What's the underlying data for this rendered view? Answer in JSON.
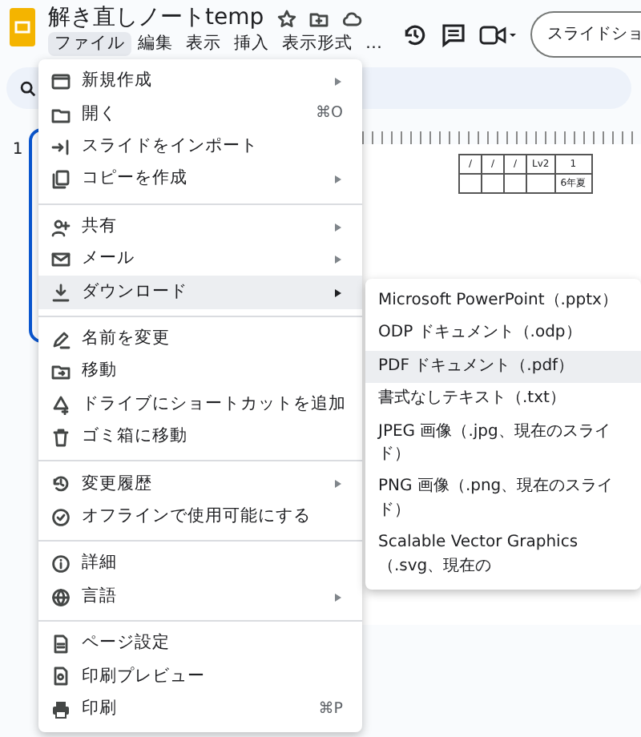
{
  "app": {
    "title": "解き直しノートtemp",
    "menubar": [
      {
        "label": "ファイル",
        "selected": true
      },
      {
        "label": "編集",
        "selected": false
      },
      {
        "label": "表示",
        "selected": false
      },
      {
        "label": "挿入",
        "selected": false
      },
      {
        "label": "表示形式",
        "selected": false
      },
      {
        "label": "…",
        "selected": false
      }
    ],
    "slideshow_button": "スライドショ"
  },
  "thumbnails": [
    {
      "number": "1",
      "selected": true
    }
  ],
  "slide": {
    "table": {
      "rows": [
        [
          "/",
          "/",
          "/",
          "Lv2",
          "1"
        ],
        [
          null,
          null,
          null,
          null,
          "6年夏"
        ]
      ]
    }
  },
  "file_menu": {
    "sections": [
      [
        {
          "label": "新規作成",
          "has_submenu": true,
          "selected": false
        },
        {
          "label": "開く",
          "shortcut": "⌘O",
          "has_submenu": false,
          "selected": false
        },
        {
          "label": "スライドをインポート",
          "has_submenu": false,
          "selected": false
        },
        {
          "label": "コピーを作成",
          "has_submenu": true,
          "selected": false
        }
      ],
      [
        {
          "label": "共有",
          "has_submenu": true,
          "selected": false
        },
        {
          "label": "メール",
          "has_submenu": true,
          "selected": false
        },
        {
          "label": "ダウンロード",
          "has_submenu": true,
          "selected": true
        }
      ],
      [
        {
          "label": "名前を変更",
          "has_submenu": false,
          "selected": false
        },
        {
          "label": "移動",
          "has_submenu": false,
          "selected": false
        },
        {
          "label": "ドライブにショートカットを追加",
          "has_submenu": false,
          "selected": false
        },
        {
          "label": "ゴミ箱に移動",
          "has_submenu": false,
          "selected": false
        }
      ],
      [
        {
          "label": "変更履歴",
          "has_submenu": true,
          "selected": false
        },
        {
          "label": "オフラインで使用可能にする",
          "has_submenu": false,
          "selected": false
        }
      ],
      [
        {
          "label": "詳細",
          "has_submenu": false,
          "selected": false
        },
        {
          "label": "言語",
          "has_submenu": true,
          "selected": false
        }
      ],
      [
        {
          "label": "ページ設定",
          "has_submenu": false,
          "selected": false
        },
        {
          "label": "印刷プレビュー",
          "has_submenu": false,
          "selected": false
        },
        {
          "label": "印刷",
          "shortcut": "⌘P",
          "has_submenu": false,
          "selected": false
        }
      ]
    ]
  },
  "download_submenu": {
    "items": [
      {
        "label": "Microsoft PowerPoint（.pptx）",
        "selected": false
      },
      {
        "label": "ODP ドキュメント（.odp）",
        "selected": false
      },
      {
        "label": "PDF ドキュメント（.pdf）",
        "selected": true
      },
      {
        "label": "書式なしテキスト（.txt）",
        "selected": false
      },
      {
        "label": "JPEG 画像（.jpg、現在のスライド）",
        "selected": false
      },
      {
        "label": "PNG 画像（.png、現在のスライド）",
        "selected": false
      },
      {
        "label": "Scalable Vector Graphics（.svg、現在の",
        "selected": false
      }
    ]
  }
}
